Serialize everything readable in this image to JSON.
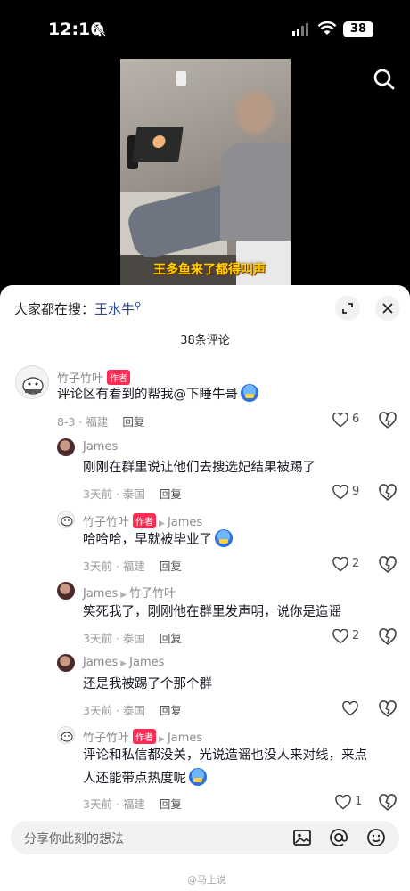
{
  "status_bar": {
    "time": "12:16",
    "battery": "38",
    "icons": [
      "bell-slash-icon",
      "signal-icon",
      "wifi-icon",
      "battery-icon"
    ]
  },
  "video": {
    "caption": "王多鱼来了都得叫声"
  },
  "sheet": {
    "trending_prefix": "大家都在搜：",
    "trending_keyword": "王水牛",
    "comment_count": "38条评论"
  },
  "comments": [
    {
      "user": "竹子竹叶",
      "author_badge": "作者",
      "reply_to": "",
      "text": "评论区有看到的帮我@下睡牛哥",
      "meta": "8-3 · 福建",
      "reply": "回复",
      "likes": "6"
    },
    {
      "user": "James",
      "author_badge": "",
      "reply_to": "",
      "text": "刚刚在群里说让他们去搜选妃结果被踢了",
      "meta": "3天前 · 泰国",
      "reply": "回复",
      "likes": "9"
    },
    {
      "user": "竹子竹叶",
      "author_badge": "作者",
      "reply_to": "James",
      "text": "哈哈哈，早就被毕业了",
      "meta": "3天前 · 福建",
      "reply": "回复",
      "likes": "2"
    },
    {
      "user": "James",
      "author_badge": "",
      "reply_to": "竹子竹叶",
      "text": "笑死我了，刚刚他在群里发声明，说你是造谣",
      "meta": "3天前 · 泰国",
      "reply": "回复",
      "likes": "2"
    },
    {
      "user": "James",
      "author_badge": "",
      "reply_to": "James",
      "text": "还是我被踢了个那个群",
      "meta": "3天前 · 泰国",
      "reply": "回复",
      "likes": ""
    },
    {
      "user": "竹子竹叶",
      "author_badge": "作者",
      "reply_to": "James",
      "text_line1": "评论和私信都没关，光说造谣也没人来对线，来点",
      "text_line2": "人还能带点热度呢",
      "meta": "3天前 · 福建",
      "reply": "回复",
      "likes": "1"
    }
  ],
  "input": {
    "placeholder": "分享你此刻的想法"
  },
  "watermark": "@马上说"
}
